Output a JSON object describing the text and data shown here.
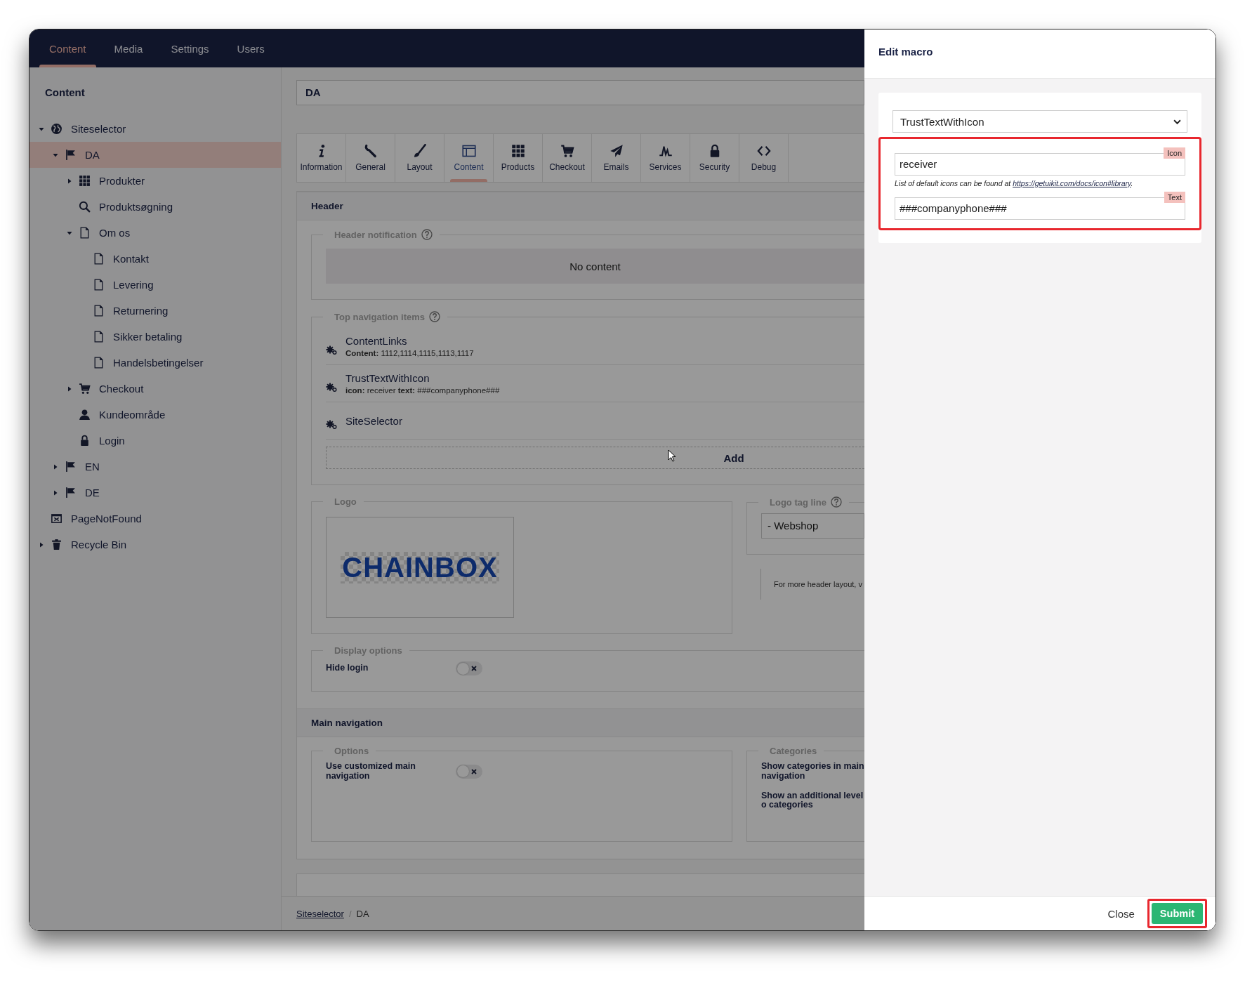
{
  "top_nav": {
    "tabs": [
      {
        "label": "Content",
        "selected": true
      },
      {
        "label": "Media",
        "selected": false
      },
      {
        "label": "Settings",
        "selected": false
      },
      {
        "label": "Users",
        "selected": false
      }
    ]
  },
  "sidebar": {
    "title": "Content",
    "tree": [
      {
        "label": "Siteselector",
        "kind": "site",
        "expanded": true,
        "selected": false,
        "children": [
          {
            "label": "DA",
            "kind": "language",
            "expanded": true,
            "selected": true,
            "children": [
              {
                "label": "Produkter",
                "kind": "grid",
                "expanded": false,
                "selected": false
              },
              {
                "label": "Produktsøgning",
                "kind": "search",
                "selected": false
              },
              {
                "label": "Om os",
                "kind": "page",
                "expanded": true,
                "selected": false,
                "children": [
                  {
                    "label": "Kontakt",
                    "kind": "page",
                    "selected": false
                  },
                  {
                    "label": "Levering",
                    "kind": "page",
                    "selected": false
                  },
                  {
                    "label": "Returnering",
                    "kind": "page",
                    "selected": false
                  },
                  {
                    "label": "Sikker betaling",
                    "kind": "page",
                    "selected": false
                  },
                  {
                    "label": "Handelsbetingelser",
                    "kind": "page",
                    "selected": false
                  }
                ]
              },
              {
                "label": "Checkout",
                "kind": "cart",
                "expanded": false,
                "selected": false
              },
              {
                "label": "Kundeområde",
                "kind": "user",
                "selected": false
              },
              {
                "label": "Login",
                "kind": "lock",
                "selected": false
              }
            ]
          },
          {
            "label": "EN",
            "kind": "language",
            "expanded": false,
            "selected": false
          },
          {
            "label": "DE",
            "kind": "language",
            "expanded": false,
            "selected": false
          }
        ]
      },
      {
        "label": "PageNotFound",
        "kind": "notfound",
        "selected": false
      },
      {
        "label": "Recycle Bin",
        "kind": "trash",
        "expanded": false,
        "selected": false
      }
    ]
  },
  "node_name": "DA",
  "content_tabs": [
    {
      "label": "Information",
      "kind": "info",
      "selected": false
    },
    {
      "label": "General",
      "kind": "wrench",
      "selected": false
    },
    {
      "label": "Layout",
      "kind": "brush",
      "selected": false
    },
    {
      "label": "Content",
      "kind": "window",
      "selected": true
    },
    {
      "label": "Products",
      "kind": "grid",
      "selected": false
    },
    {
      "label": "Checkout",
      "kind": "cart",
      "selected": false
    },
    {
      "label": "Emails",
      "kind": "plane",
      "selected": false
    },
    {
      "label": "Services",
      "kind": "pulse",
      "selected": false
    },
    {
      "label": "Security",
      "kind": "lock",
      "selected": false
    },
    {
      "label": "Debug",
      "kind": "code",
      "selected": false
    }
  ],
  "header_section": {
    "title": "Header",
    "notification": {
      "legend": "Header notification",
      "help": true,
      "empty_text": "No content"
    },
    "top_navigation": {
      "legend": "Top navigation items",
      "help": true,
      "items": [
        {
          "name": "ContentLinks",
          "params": "**Content:** 1112,1114,1115,1113,1117"
        },
        {
          "name": "TrustTextWithIcon",
          "params": "**icon:** receiver **text:** ###companyphone###"
        },
        {
          "name": "SiteSelector"
        }
      ],
      "add_label": "Add"
    },
    "logo": {
      "legend": "Logo",
      "help": false,
      "image_text": "CHAINBOX"
    },
    "logo_tag_line": {
      "legend": "Logo tag line",
      "help": true,
      "value": "- Webshop"
    },
    "note": "For more header layout, v",
    "display_options": {
      "legend": "Display options",
      "help": false,
      "toggles": [
        {
          "label": "Hide login",
          "on": false
        }
      ]
    }
  },
  "main_navigation": {
    "title": "Main navigation",
    "options": {
      "legend": "Options",
      "help": false,
      "toggles": [
        {
          "label": "Use customized main navigation",
          "on": false
        }
      ]
    },
    "categories": {
      "legend": "Categories",
      "help": false,
      "labels": [
        "Show categories in main navigation",
        "Show an additional level o categories"
      ]
    }
  },
  "breadcrumb": {
    "separator": "/",
    "items": [
      {
        "label": "Siteselector",
        "link": true
      },
      {
        "label": "DA",
        "link": false
      }
    ]
  },
  "edit_macro": {
    "title": "Edit macro",
    "macro": "TrustTextWithIcon",
    "parameters_highlighted": true,
    "parameters": [
      {
        "label": "Icon",
        "value": "receiver",
        "help": "List of default icons can be found at",
        "help_link": "https://getuikit.com/docs/icon#library",
        "help_end": "."
      },
      {
        "label": "Text",
        "value": "###companyphone###"
      }
    ],
    "close": "Close",
    "submit": "Submit",
    "submit_highlighted": true
  }
}
